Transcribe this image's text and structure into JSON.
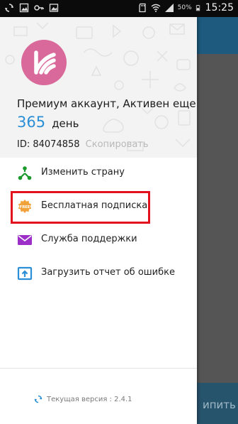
{
  "status_bar": {
    "battery_percent": "50%",
    "time": "15:25",
    "icons": [
      "sync-icon",
      "image-icon",
      "key-icon",
      "gallery-icon",
      "sd-card-icon",
      "wifi-icon",
      "signal-icon",
      "battery-icon"
    ]
  },
  "drawer": {
    "premium_text": "Премиум аккаунт, Активен еще",
    "days_count": "365",
    "days_word": "день",
    "id_text": "ID: 84074858",
    "copy_label": "Скопировать",
    "menu": [
      {
        "label": "Изменить страну",
        "icon": "change-country-icon",
        "color": "#1a9a2a"
      },
      {
        "label": "Бесплатная подписка",
        "icon": "free-badge-icon",
        "color": "#f2a23b"
      },
      {
        "label": "Служба поддержки",
        "icon": "mail-icon",
        "color": "#9b2fc7"
      },
      {
        "label": "Загрузить отчет об ошибке",
        "icon": "upload-report-icon",
        "color": "#2a8fd6"
      }
    ],
    "version_text": "Текущая версия : 2.4.1"
  },
  "background_app": {
    "bottom_button_partial": "ипить"
  },
  "colors": {
    "accent_blue": "#2a8fd6",
    "logo_pink": "#d9699a",
    "highlight_red": "#e1121d",
    "appbar_blue": "#1d5a7d"
  }
}
